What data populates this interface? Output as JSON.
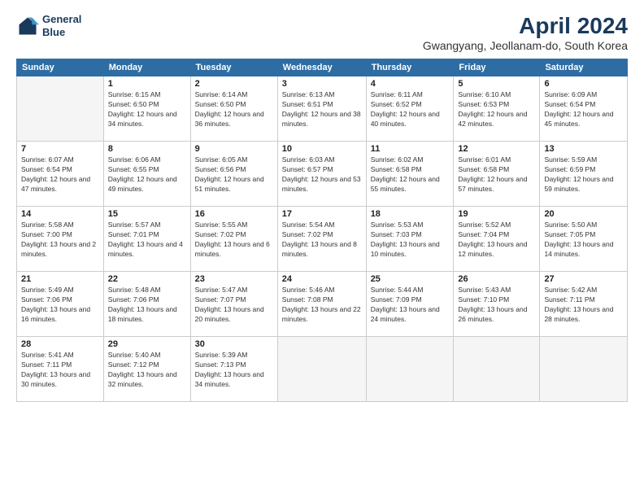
{
  "logo": {
    "line1": "General",
    "line2": "Blue"
  },
  "title": "April 2024",
  "subtitle": "Gwangyang, Jeollanam-do, South Korea",
  "columns": [
    "Sunday",
    "Monday",
    "Tuesday",
    "Wednesday",
    "Thursday",
    "Friday",
    "Saturday"
  ],
  "weeks": [
    [
      {
        "day": "",
        "sunrise": "",
        "sunset": "",
        "daylight": ""
      },
      {
        "day": "1",
        "sunrise": "Sunrise: 6:15 AM",
        "sunset": "Sunset: 6:50 PM",
        "daylight": "Daylight: 12 hours and 34 minutes."
      },
      {
        "day": "2",
        "sunrise": "Sunrise: 6:14 AM",
        "sunset": "Sunset: 6:50 PM",
        "daylight": "Daylight: 12 hours and 36 minutes."
      },
      {
        "day": "3",
        "sunrise": "Sunrise: 6:13 AM",
        "sunset": "Sunset: 6:51 PM",
        "daylight": "Daylight: 12 hours and 38 minutes."
      },
      {
        "day": "4",
        "sunrise": "Sunrise: 6:11 AM",
        "sunset": "Sunset: 6:52 PM",
        "daylight": "Daylight: 12 hours and 40 minutes."
      },
      {
        "day": "5",
        "sunrise": "Sunrise: 6:10 AM",
        "sunset": "Sunset: 6:53 PM",
        "daylight": "Daylight: 12 hours and 42 minutes."
      },
      {
        "day": "6",
        "sunrise": "Sunrise: 6:09 AM",
        "sunset": "Sunset: 6:54 PM",
        "daylight": "Daylight: 12 hours and 45 minutes."
      }
    ],
    [
      {
        "day": "7",
        "sunrise": "Sunrise: 6:07 AM",
        "sunset": "Sunset: 6:54 PM",
        "daylight": "Daylight: 12 hours and 47 minutes."
      },
      {
        "day": "8",
        "sunrise": "Sunrise: 6:06 AM",
        "sunset": "Sunset: 6:55 PM",
        "daylight": "Daylight: 12 hours and 49 minutes."
      },
      {
        "day": "9",
        "sunrise": "Sunrise: 6:05 AM",
        "sunset": "Sunset: 6:56 PM",
        "daylight": "Daylight: 12 hours and 51 minutes."
      },
      {
        "day": "10",
        "sunrise": "Sunrise: 6:03 AM",
        "sunset": "Sunset: 6:57 PM",
        "daylight": "Daylight: 12 hours and 53 minutes."
      },
      {
        "day": "11",
        "sunrise": "Sunrise: 6:02 AM",
        "sunset": "Sunset: 6:58 PM",
        "daylight": "Daylight: 12 hours and 55 minutes."
      },
      {
        "day": "12",
        "sunrise": "Sunrise: 6:01 AM",
        "sunset": "Sunset: 6:58 PM",
        "daylight": "Daylight: 12 hours and 57 minutes."
      },
      {
        "day": "13",
        "sunrise": "Sunrise: 5:59 AM",
        "sunset": "Sunset: 6:59 PM",
        "daylight": "Daylight: 12 hours and 59 minutes."
      }
    ],
    [
      {
        "day": "14",
        "sunrise": "Sunrise: 5:58 AM",
        "sunset": "Sunset: 7:00 PM",
        "daylight": "Daylight: 13 hours and 2 minutes."
      },
      {
        "day": "15",
        "sunrise": "Sunrise: 5:57 AM",
        "sunset": "Sunset: 7:01 PM",
        "daylight": "Daylight: 13 hours and 4 minutes."
      },
      {
        "day": "16",
        "sunrise": "Sunrise: 5:55 AM",
        "sunset": "Sunset: 7:02 PM",
        "daylight": "Daylight: 13 hours and 6 minutes."
      },
      {
        "day": "17",
        "sunrise": "Sunrise: 5:54 AM",
        "sunset": "Sunset: 7:02 PM",
        "daylight": "Daylight: 13 hours and 8 minutes."
      },
      {
        "day": "18",
        "sunrise": "Sunrise: 5:53 AM",
        "sunset": "Sunset: 7:03 PM",
        "daylight": "Daylight: 13 hours and 10 minutes."
      },
      {
        "day": "19",
        "sunrise": "Sunrise: 5:52 AM",
        "sunset": "Sunset: 7:04 PM",
        "daylight": "Daylight: 13 hours and 12 minutes."
      },
      {
        "day": "20",
        "sunrise": "Sunrise: 5:50 AM",
        "sunset": "Sunset: 7:05 PM",
        "daylight": "Daylight: 13 hours and 14 minutes."
      }
    ],
    [
      {
        "day": "21",
        "sunrise": "Sunrise: 5:49 AM",
        "sunset": "Sunset: 7:06 PM",
        "daylight": "Daylight: 13 hours and 16 minutes."
      },
      {
        "day": "22",
        "sunrise": "Sunrise: 5:48 AM",
        "sunset": "Sunset: 7:06 PM",
        "daylight": "Daylight: 13 hours and 18 minutes."
      },
      {
        "day": "23",
        "sunrise": "Sunrise: 5:47 AM",
        "sunset": "Sunset: 7:07 PM",
        "daylight": "Daylight: 13 hours and 20 minutes."
      },
      {
        "day": "24",
        "sunrise": "Sunrise: 5:46 AM",
        "sunset": "Sunset: 7:08 PM",
        "daylight": "Daylight: 13 hours and 22 minutes."
      },
      {
        "day": "25",
        "sunrise": "Sunrise: 5:44 AM",
        "sunset": "Sunset: 7:09 PM",
        "daylight": "Daylight: 13 hours and 24 minutes."
      },
      {
        "day": "26",
        "sunrise": "Sunrise: 5:43 AM",
        "sunset": "Sunset: 7:10 PM",
        "daylight": "Daylight: 13 hours and 26 minutes."
      },
      {
        "day": "27",
        "sunrise": "Sunrise: 5:42 AM",
        "sunset": "Sunset: 7:11 PM",
        "daylight": "Daylight: 13 hours and 28 minutes."
      }
    ],
    [
      {
        "day": "28",
        "sunrise": "Sunrise: 5:41 AM",
        "sunset": "Sunset: 7:11 PM",
        "daylight": "Daylight: 13 hours and 30 minutes."
      },
      {
        "day": "29",
        "sunrise": "Sunrise: 5:40 AM",
        "sunset": "Sunset: 7:12 PM",
        "daylight": "Daylight: 13 hours and 32 minutes."
      },
      {
        "day": "30",
        "sunrise": "Sunrise: 5:39 AM",
        "sunset": "Sunset: 7:13 PM",
        "daylight": "Daylight: 13 hours and 34 minutes."
      },
      {
        "day": "",
        "sunrise": "",
        "sunset": "",
        "daylight": ""
      },
      {
        "day": "",
        "sunrise": "",
        "sunset": "",
        "daylight": ""
      },
      {
        "day": "",
        "sunrise": "",
        "sunset": "",
        "daylight": ""
      },
      {
        "day": "",
        "sunrise": "",
        "sunset": "",
        "daylight": ""
      }
    ]
  ]
}
